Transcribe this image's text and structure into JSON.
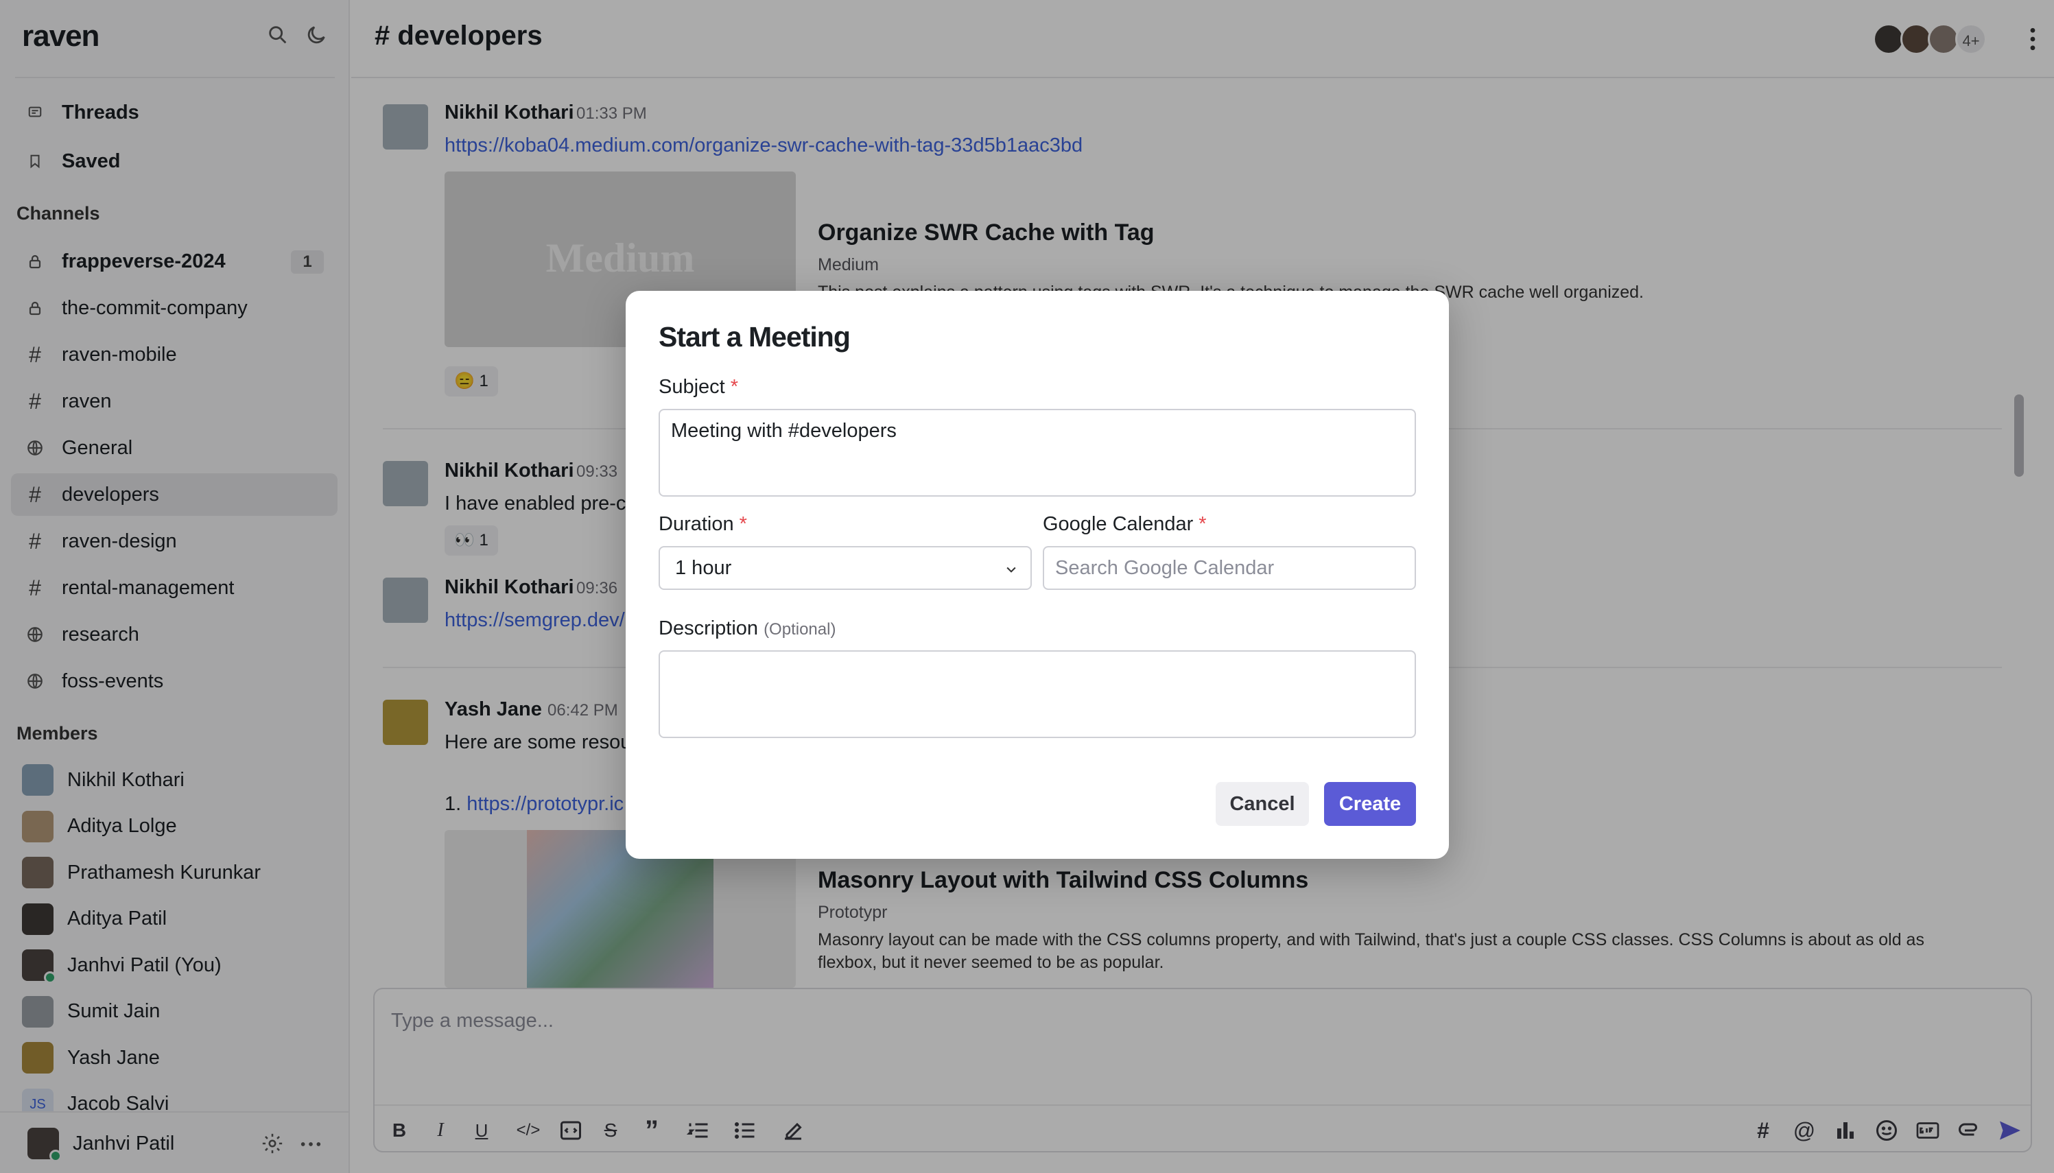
{
  "app": {
    "logo": "raven"
  },
  "sidebar": {
    "nav": [
      {
        "label": "Threads",
        "icon": "threads-icon"
      },
      {
        "label": "Saved",
        "icon": "bookmark-icon"
      }
    ],
    "channels_heading": "Channels",
    "channels": [
      {
        "label": "frappeverse-2024",
        "icon": "lock-icon",
        "unread": "1",
        "bold": true
      },
      {
        "label": "the-commit-company",
        "icon": "lock-icon"
      },
      {
        "label": "raven-mobile",
        "icon": "hash-icon"
      },
      {
        "label": "raven",
        "icon": "hash-icon"
      },
      {
        "label": "General",
        "icon": "globe-icon"
      },
      {
        "label": "developers",
        "icon": "hash-icon",
        "active": true
      },
      {
        "label": "raven-design",
        "icon": "hash-icon"
      },
      {
        "label": "rental-management",
        "icon": "hash-icon"
      },
      {
        "label": "research",
        "icon": "globe-icon"
      },
      {
        "label": "foss-events",
        "icon": "globe-icon"
      }
    ],
    "members_heading": "Members",
    "members": [
      {
        "name": "Nikhil Kothari",
        "color": "#8aa3b8"
      },
      {
        "name": "Aditya Lolge",
        "color": "#b59a7a"
      },
      {
        "name": "Prathamesh Kurunkar",
        "color": "#7a6b5e"
      },
      {
        "name": "Aditya Patil",
        "color": "#3e3a36"
      },
      {
        "name": "Janhvi Patil (You)",
        "color": "#4b4440",
        "online": true
      },
      {
        "name": "Sumit Jain",
        "color": "#9aa0a6"
      },
      {
        "name": "Yash Jane",
        "color": "#a98a3d"
      },
      {
        "name": "Jacob Salvi",
        "initials": "JS",
        "color": "#dbe3f0"
      }
    ],
    "footer_user": "Janhvi Patil"
  },
  "header": {
    "channel": "developers",
    "more_members": "4+"
  },
  "messages": [
    {
      "author": "Nikhil Kothari",
      "time": "01:33 PM",
      "link": "https://koba04.medium.com/organize-swr-cache-with-tag-33d5b1aac3bd",
      "preview": {
        "image_text": "Medium",
        "title": "Organize SWR Cache with Tag",
        "site": "Medium",
        "desc": "This post explains a pattern using tags with SWR. It's a technique to manage the SWR cache well organized."
      },
      "reaction": "😑 1"
    },
    {
      "author": "Nikhil Kothari",
      "time": "09:33",
      "text": "I have enabled pre-c",
      "reaction": "👀 1"
    },
    {
      "author": "Nikhil Kothari",
      "time": "09:36",
      "link": "https://semgrep.dev/"
    },
    {
      "author": "Yash Jane",
      "time": "06:42 PM",
      "text": "Here are some resou",
      "list_prefix": "1.",
      "link": "https://prototypr.ic",
      "preview": {
        "title": "Masonry Layout with Tailwind CSS Columns",
        "site": "Prototypr",
        "desc": "Masonry layout can be made with the CSS columns property, and with Tailwind, that's just a couple CSS classes. CSS Columns is about as old as flexbox, but it never seemed to be as popular."
      }
    }
  ],
  "composer": {
    "placeholder": "Type a message..."
  },
  "modal": {
    "title": "Start a Meeting",
    "subject_label": "Subject",
    "subject_value": "Meeting with #developers",
    "required_mark": "*",
    "duration_label": "Duration",
    "duration_value": "1 hour",
    "calendar_label": "Google Calendar",
    "calendar_placeholder": "Search Google Calendar",
    "description_label": "Description",
    "description_optional": "(Optional)",
    "cancel": "Cancel",
    "create": "Create"
  },
  "colors": {
    "accent": "#5b5bd6",
    "link": "#3e63dd",
    "required": "#e5484d"
  }
}
